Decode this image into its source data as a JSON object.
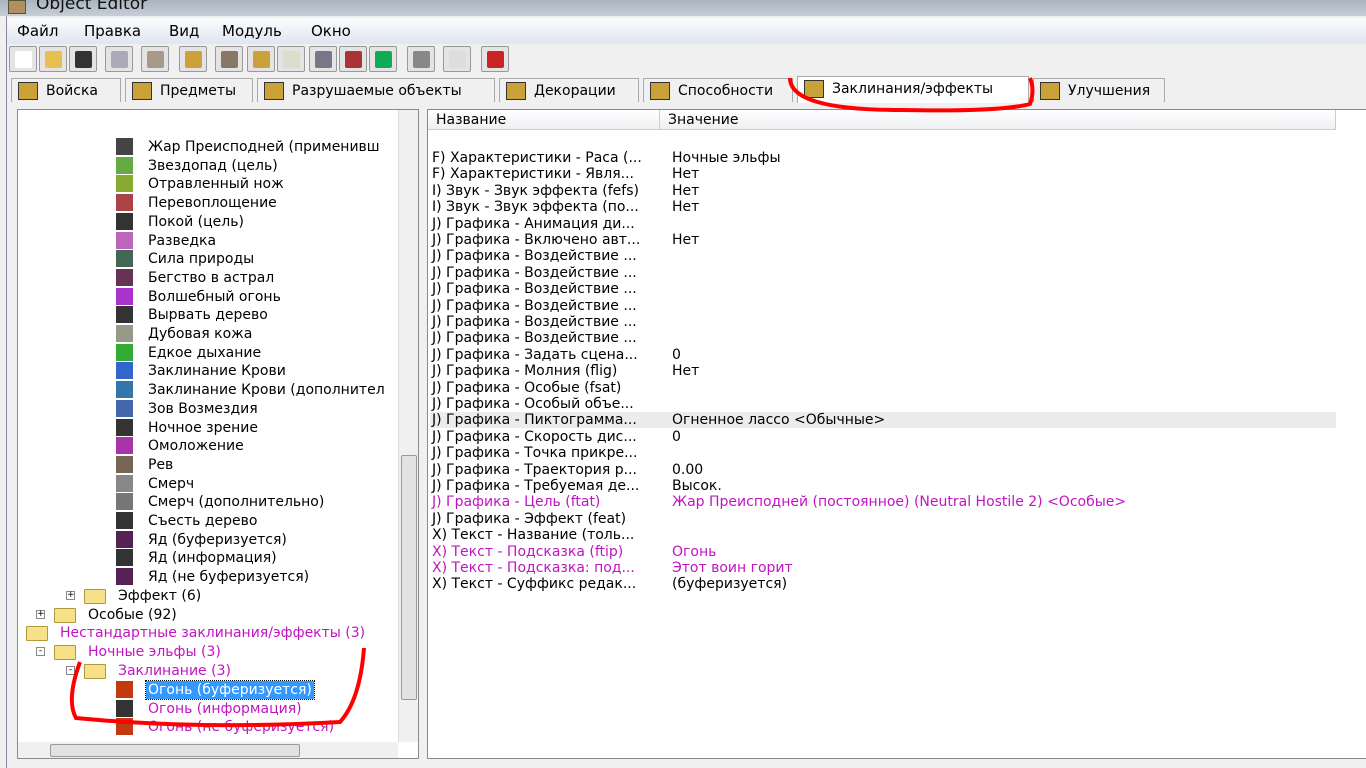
{
  "window": {
    "title": "Object Editor"
  },
  "menu": [
    "Файл",
    "Правка",
    "Вид",
    "Модуль",
    "Окно"
  ],
  "toolbar": [
    "new-icon",
    "open-icon",
    "save-icon",
    "copy-icon",
    "paste-icon",
    "abilities-icon",
    "terrain-icon",
    "text-icon",
    "sound-icon",
    "units-icon",
    "items-icon",
    "object-icon",
    "doodad-icon",
    "import-icon",
    "test-map-icon"
  ],
  "tabs": [
    {
      "label": "Войска"
    },
    {
      "label": "Предметы"
    },
    {
      "label": "Разрушаемые объекты"
    },
    {
      "label": "Декорации"
    },
    {
      "label": "Способности"
    },
    {
      "label": "Заклинания/эффекты",
      "active": true
    },
    {
      "label": "Улучшения"
    }
  ],
  "tree": {
    "leaves": [
      "Жар Преисподней (применивш",
      "Звездопад (цель)",
      "Отравленный нож",
      "Перевоплощение",
      "Покой (цель)",
      "Разведка",
      "Сила природы",
      "Бегство в астрал",
      "Волшебный огонь",
      "Вырвать дерево",
      "Дубовая кожа",
      "Едкое дыхание",
      "Заклинание Крови",
      "Заклинание Крови (дополнител",
      "Зов Возмездия",
      "Ночное зрение",
      "Омоложение",
      "Рев",
      "Смерч",
      "Смерч (дополнительно)",
      "Съесть дерево",
      "Яд (буферизуется)",
      "Яд (информация)",
      "Яд (не буферизуется)"
    ],
    "folders": [
      {
        "label": "Эффект (6)",
        "expander": "+"
      },
      {
        "label": "Особые (92)",
        "expander": "+"
      },
      {
        "label": "Нестандартные заклинания/эффекты (3)",
        "custom": true
      },
      {
        "label": "Ночные эльфы (3)",
        "expander": "-",
        "custom": true
      },
      {
        "label": "Заклинание (3)",
        "expander": "-",
        "custom": true
      }
    ],
    "custom_leaves": [
      {
        "label": "Огонь (буферизуется)",
        "selected": true
      },
      {
        "label": "Огонь (информация)"
      },
      {
        "label": "Огонь (не буферизуется)"
      }
    ]
  },
  "props": {
    "headers": [
      "Название",
      "Значение"
    ],
    "rows": [
      {
        "n": "F) Характеристики - Раса (...",
        "v": "Ночные эльфы"
      },
      {
        "n": "F) Характеристики - Явля...",
        "v": "Нет"
      },
      {
        "n": "I) Звук - Звук эффекта (fefs)",
        "v": "Нет"
      },
      {
        "n": "I) Звук - Звук эффекта (по...",
        "v": "Нет"
      },
      {
        "n": "J) Графика - Анимация ди...",
        "v": ""
      },
      {
        "n": "J) Графика - Включено авт...",
        "v": "Нет"
      },
      {
        "n": "J) Графика - Воздействие ...",
        "v": ""
      },
      {
        "n": "J) Графика - Воздействие ...",
        "v": ""
      },
      {
        "n": "J) Графика - Воздействие ...",
        "v": ""
      },
      {
        "n": "J) Графика - Воздействие ...",
        "v": ""
      },
      {
        "n": "J) Графика - Воздействие ...",
        "v": ""
      },
      {
        "n": "J) Графика - Воздействие ...",
        "v": ""
      },
      {
        "n": "J) Графика - Задать сцена...",
        "v": "0"
      },
      {
        "n": "J) Графика - Молния (flig)",
        "v": "Нет"
      },
      {
        "n": "J) Графика - Особые (fsat)",
        "v": ""
      },
      {
        "n": "J) Графика - Особый объе...",
        "v": ""
      },
      {
        "n": "J) Графика - Пиктограмма...",
        "v": "Огненное лассо <Обычные>",
        "highlight": true
      },
      {
        "n": "J) Графика - Скорость дис...",
        "v": "0"
      },
      {
        "n": "J) Графика - Точка прикре...",
        "v": ""
      },
      {
        "n": "J) Графика - Траектория р...",
        "v": "0.00"
      },
      {
        "n": "J) Графика - Требуемая де...",
        "v": "Высок."
      },
      {
        "n": "J) Графика - Цель (ftat)",
        "v": "Жар Преисподней (постоянное) (Neutral Hostile 2) <Особые>",
        "custom": true
      },
      {
        "n": "J) Графика - Эффект (feat)",
        "v": ""
      },
      {
        "n": "X) Текст - Название (толь...",
        "v": ""
      },
      {
        "n": "X) Текст - Подсказка (ftip)",
        "v": "Огонь",
        "custom": true
      },
      {
        "n": "X) Текст - Подсказка: под...",
        "v": "Этот воин горит",
        "custom": true
      },
      {
        "n": "X) Текст - Суффикс редак...",
        "v": " (буферизуется)"
      }
    ]
  },
  "colors": {
    "custom": "#c015c0",
    "selection": "#3399ff",
    "annotation": "#ff0000"
  }
}
